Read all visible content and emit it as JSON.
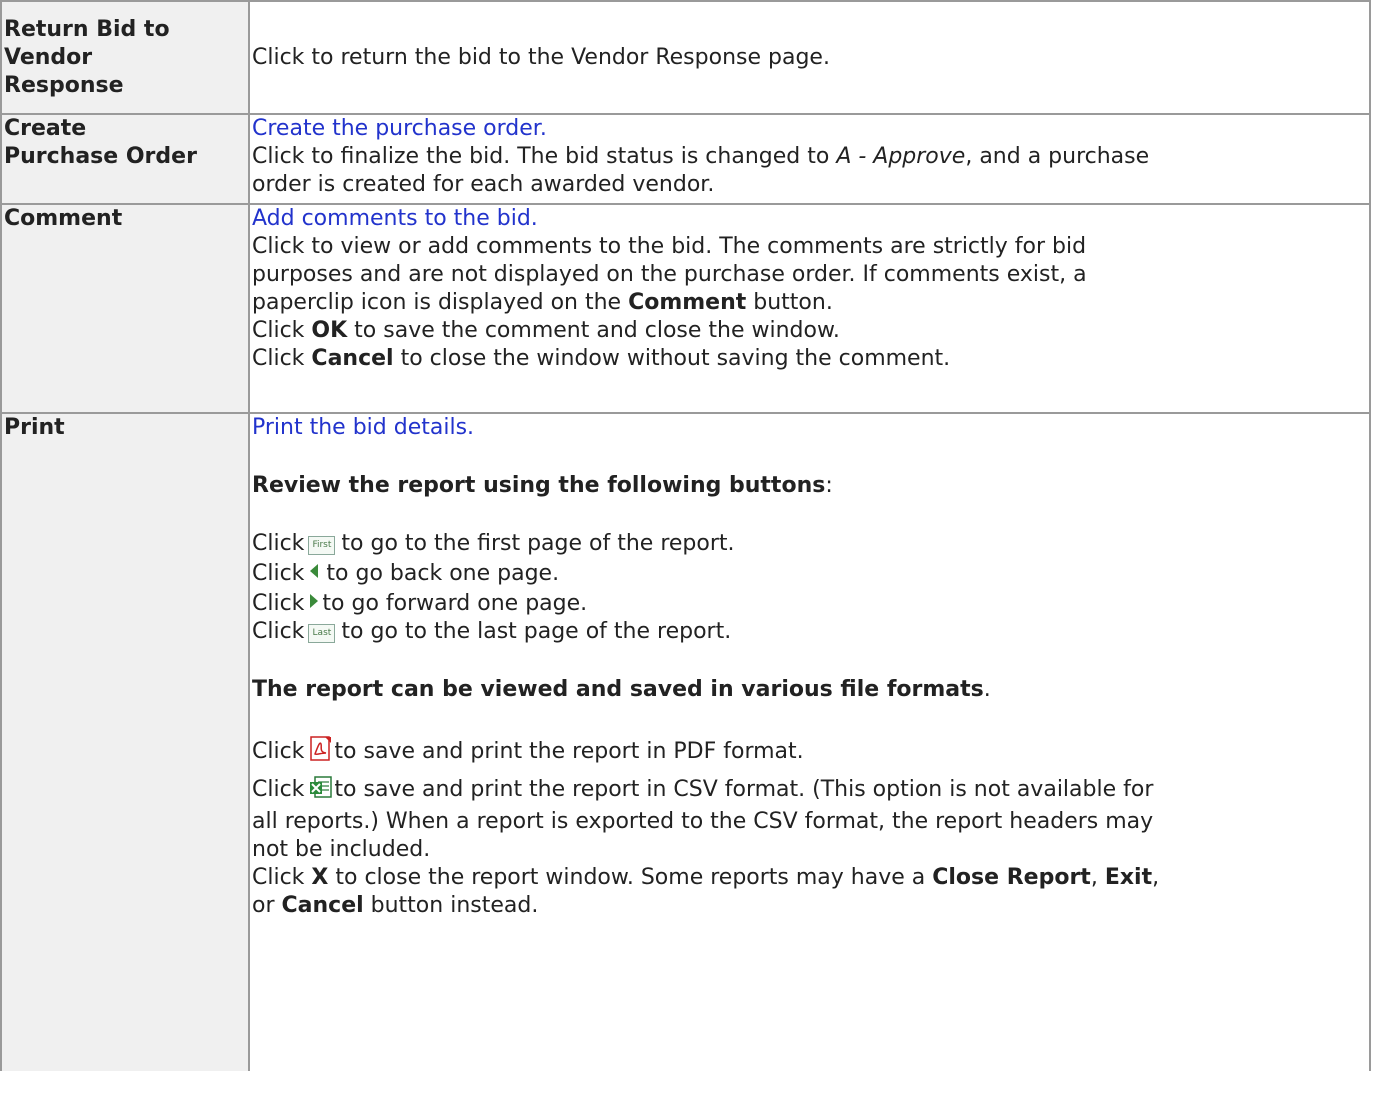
{
  "rows": {
    "return_bid": {
      "key_line1": "Return Bid to",
      "key_line2": "Vendor",
      "key_line3": "Response",
      "desc": "Click to return the bid to the Vendor Response page."
    },
    "create_po": {
      "key_line1": "Create",
      "key_line2": "Purchase Order",
      "link": "Create the purchase order.",
      "desc_pre": "Click to finalize the bid. The bid status is changed to ",
      "desc_status": "A - Approve",
      "desc_post": ", and a purchase",
      "desc_line2": "order is created for each awarded vendor."
    },
    "comment": {
      "key": "Comment",
      "link": "Add comments to the bid.",
      "desc1": "Click to view or add comments to the bid. The comments are strictly for bid",
      "desc2": "purposes and are not displayed on the purchase order. If comments exist, a",
      "desc3_pre": "paperclip icon is displayed on the ",
      "desc3_bold": "Comment",
      "desc3_post": " button.",
      "ok_pre": "Click ",
      "ok_bold": "OK",
      "ok_post": " to save the comment and close the window.",
      "cancel_pre": "Click ",
      "cancel_bold": "Cancel",
      "cancel_post": " to close the window without saving the comment."
    },
    "print": {
      "key": "Print",
      "link": "Print the bid details.",
      "review_heading": "Review the report using the following buttons",
      "review_colon": ":",
      "click": "Click",
      "first_icon_label": "First",
      "first_text": "to go to the first page of the report.",
      "back_text": "to go back one page.",
      "forward_text": "to go forward one page.",
      "last_icon_label": "Last",
      "last_text": "to go to the last page of the report.",
      "formats_heading": "The report can be viewed and saved in various file formats",
      "formats_period": ".",
      "pdf_text": "to save and print the report in PDF format.",
      "csv_text1": "to save and print the report in CSV format. (This option is not available for",
      "csv_text2": "all reports.) When a report is exported to the CSV format, the report headers may",
      "csv_text3": "not be included.",
      "x_pre": "Click ",
      "x_bold": "X",
      "x_post": " to close the report window. Some reports may have a ",
      "close_report_bold": "Close Report",
      "comma1": ", ",
      "exit_bold": "Exit",
      "comma2": ",",
      "or_pre": "or ",
      "cancel_bold": "Cancel",
      "or_post": " button instead."
    }
  },
  "icons": {
    "first": "first-page-icon",
    "previous": "previous-page-icon",
    "next": "next-page-icon",
    "last": "last-page-icon",
    "pdf": "pdf-icon",
    "csv": "excel-csv-icon"
  },
  "colors": {
    "link": "#2233cc",
    "key_cell_bg": "#f0f0f0",
    "border": "#9a9a9a"
  }
}
